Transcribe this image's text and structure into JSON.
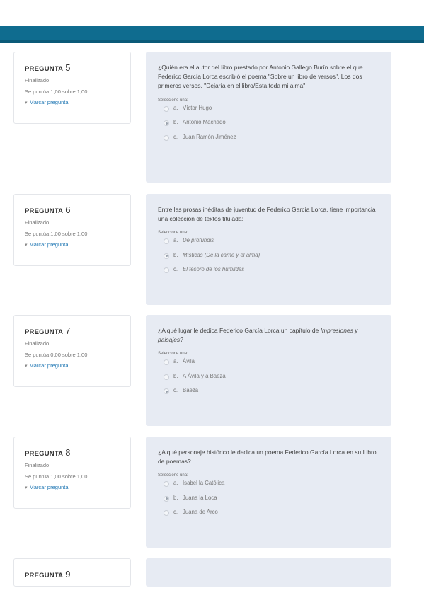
{
  "header": {},
  "questions": [
    {
      "title": "PREGUNTA",
      "number": "5",
      "state": "Finalizado",
      "grade": "Se puntúa 1,00 sobre 1,00",
      "flag_label": "Marcar pregunta",
      "text": "¿Quién era el autor del libro prestado por Antonio Gallego Burín sobre el que Federico García Lorca escribió el poema \"Sobre un libro de versos\". Los dos primeros versos. \"Dejaría en el libro/Esta toda mi alma\"",
      "prompt": "Seleccione una:",
      "answers": [
        {
          "letter": "a.",
          "text": "Víctor Hugo",
          "selected": false
        },
        {
          "letter": "b.",
          "text": "Antonio Machado",
          "selected": true
        },
        {
          "letter": "c.",
          "text": "Juan Ramón Jiménez",
          "selected": false
        }
      ]
    },
    {
      "title": "PREGUNTA",
      "number": "6",
      "state": "Finalizado",
      "grade": "Se puntúa 1,00 sobre 1,00",
      "flag_label": "Marcar pregunta",
      "text": "Entre las prosas inéditas de juventud de Federico García Lorca, tiene importancia una colección de textos titulada:",
      "prompt": "Seleccione una:",
      "answers": [
        {
          "letter": "a.",
          "text": "De profundis",
          "selected": false,
          "italic": true
        },
        {
          "letter": "b.",
          "text": "Místicas (De la carne y el alma)",
          "selected": true,
          "italic": true
        },
        {
          "letter": "c.",
          "text": "El tesoro de los humildes",
          "selected": false,
          "italic": true
        }
      ]
    },
    {
      "title": "PREGUNTA",
      "number": "7",
      "state": "Finalizado",
      "grade": "Se puntúa 0,00 sobre 1,00",
      "flag_label": "Marcar pregunta",
      "text_before": "¿A qué lugar le dedica Federico García Lorca un capítulo de ",
      "text_italic": "Impresiones y paisajes",
      "text_after": "?",
      "prompt": "Seleccione una:",
      "answers": [
        {
          "letter": "a.",
          "text": "Ávila",
          "selected": false
        },
        {
          "letter": "b.",
          "text": "A Ávila y a Baeza",
          "selected": false
        },
        {
          "letter": "c.",
          "text": "Baeza",
          "selected": true
        }
      ]
    },
    {
      "title": "PREGUNTA",
      "number": "8",
      "state": "Finalizado",
      "grade": "Se puntúa 1,00 sobre 1,00",
      "flag_label": "Marcar pregunta",
      "text": "¿A qué personaje histórico le dedica un poema Federico García Lorca en su Libro de poemas?",
      "prompt": "Seleccione una:",
      "answers": [
        {
          "letter": "a.",
          "text": "Isabel la Católica",
          "selected": false
        },
        {
          "letter": "b.",
          "text": "Juana la Loca",
          "selected": true
        },
        {
          "letter": "c.",
          "text": "Juana de Arco",
          "selected": false
        }
      ]
    },
    {
      "title": "PREGUNTA",
      "number": "9"
    }
  ]
}
